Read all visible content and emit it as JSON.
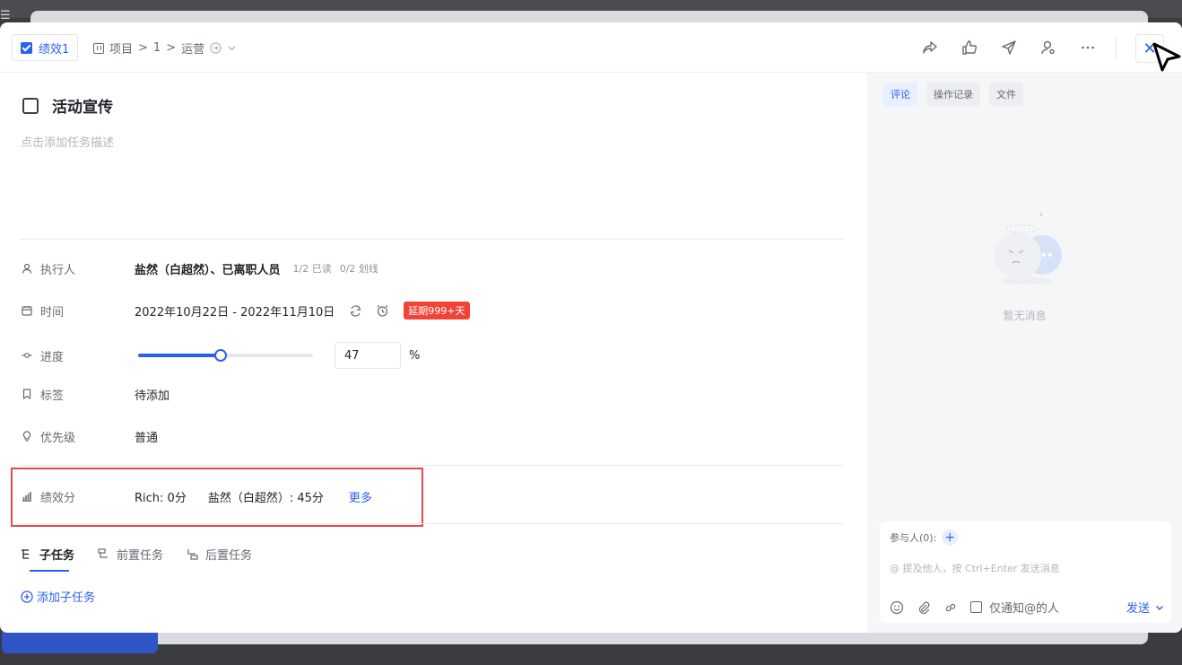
{
  "backdrop": {
    "menu_glyph": "☰"
  },
  "header": {
    "tag_label": "绩效1",
    "breadcrumb": [
      "项目",
      ">",
      "1",
      ">",
      "运营"
    ],
    "actions": [
      "share-icon",
      "thumbs-up-icon",
      "send-icon",
      "user-switch-icon",
      "more-icon"
    ],
    "close_glyph": "✕"
  },
  "task": {
    "title": "活动宣传",
    "description_placeholder": "点击添加任务描述"
  },
  "fields": {
    "assignee": {
      "label": "执行人",
      "value": "盐然（白超然）、已离职人员",
      "read": "1/2 已读",
      "strike": "0/2 划线"
    },
    "time": {
      "label": "时间",
      "value": "2022年10月22日 - 2022年11月10日",
      "overdue": "延期999+天"
    },
    "progress": {
      "label": "进度",
      "value": 47,
      "display": "47",
      "unit": "%"
    },
    "tags": {
      "label": "标签",
      "value": "待添加"
    },
    "priority": {
      "label": "优先级",
      "value": "普通"
    },
    "score": {
      "label": "绩效分",
      "entry1": "Rich: 0分",
      "entry2": "盐然（白超然）: 45分",
      "more": "更多"
    }
  },
  "subtabs": {
    "items": [
      "子任务",
      "前置任务",
      "后置任务"
    ],
    "active": 0,
    "add_label": "添加子任务"
  },
  "side": {
    "tabs": [
      "评论",
      "操作记录",
      "文件"
    ],
    "active_tab": 0,
    "empty_text": "暂无消息",
    "participants_label": "参与人(0):",
    "input_placeholder": "@ 提及他人，按 Ctrl+Enter 发送消息",
    "notify_label": "仅通知@的人",
    "send_label": "发送"
  },
  "colors": {
    "accent": "#2b5ff0",
    "danger": "#f04438",
    "highlight_box": "#e5484d"
  }
}
